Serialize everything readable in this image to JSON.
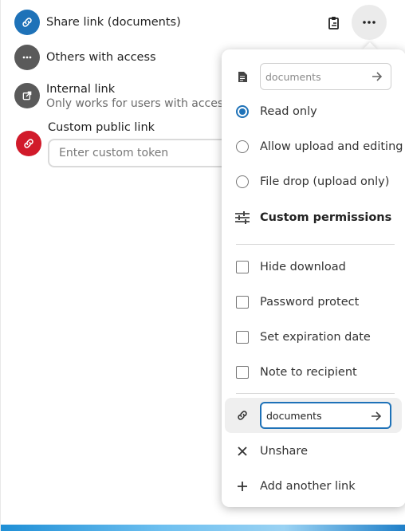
{
  "shares": {
    "share_link": {
      "title": "Share link (documents)",
      "icon": "link-icon"
    },
    "others": {
      "title": "Others with access",
      "icon": "more-horizontal-icon"
    },
    "internal": {
      "title": "Internal link",
      "subtitle": "Only works for users with access to this folder",
      "icon": "external-link-icon"
    },
    "custom": {
      "label": "Custom public link",
      "placeholder": "Enter custom token",
      "icon": "link-icon"
    }
  },
  "toolbar": {
    "copy_icon": "clipboard-icon",
    "more_icon": "more-horizontal-icon"
  },
  "menu": {
    "label_input": {
      "placeholder": "documents",
      "icon": "document-icon"
    },
    "permissions": [
      {
        "label": "Read only",
        "selected": true
      },
      {
        "label": "Allow upload and editing",
        "selected": false
      },
      {
        "label": "File drop (upload only)",
        "selected": false
      }
    ],
    "custom_permissions": "Custom permissions",
    "options": [
      {
        "label": "Hide download",
        "checked": false
      },
      {
        "label": "Password protect",
        "checked": false
      },
      {
        "label": "Set expiration date",
        "checked": false
      },
      {
        "label": "Note to recipient",
        "checked": false
      }
    ],
    "token_input": {
      "value": "documents"
    },
    "unshare": "Unshare",
    "add_another": "Add another link"
  },
  "colors": {
    "accent": "#1e72b8",
    "danger": "#d11a2a",
    "neutral": "#5a5a5a"
  }
}
